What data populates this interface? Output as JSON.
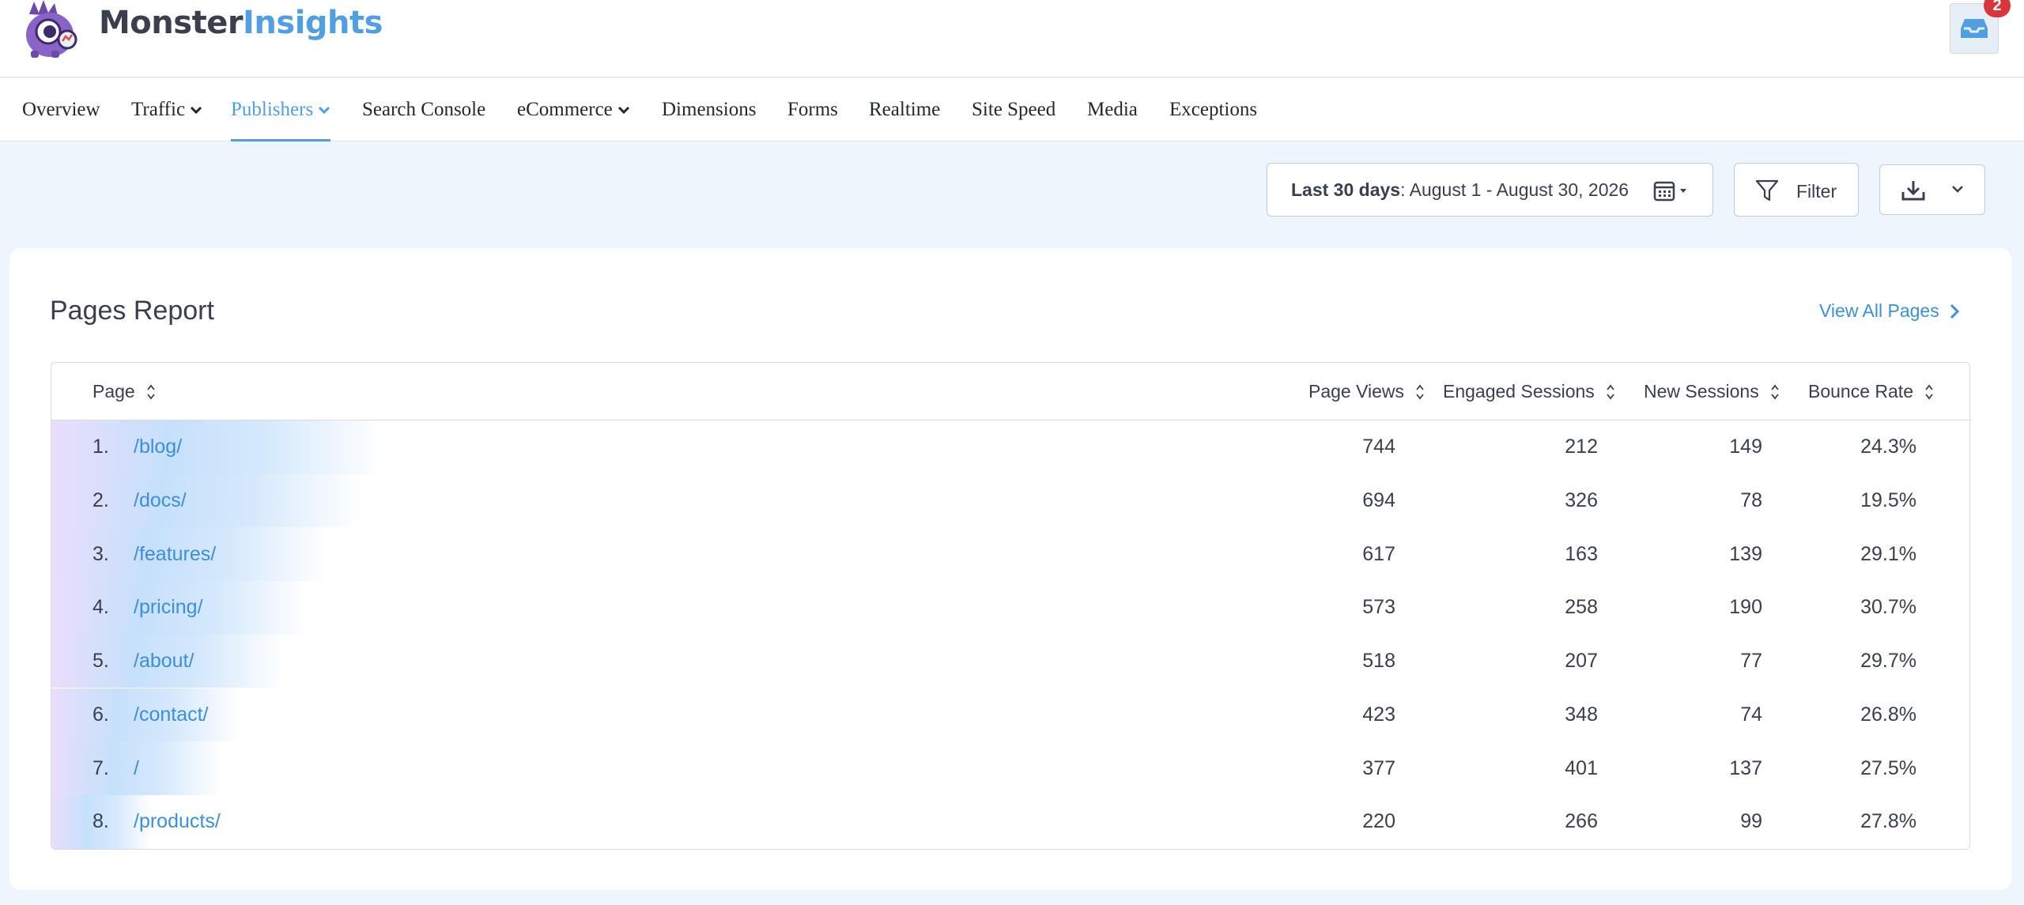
{
  "brand": {
    "monster": "Monster",
    "insights": "Insights"
  },
  "notifications": {
    "count": "2",
    "icon": "inbox-icon"
  },
  "nav": {
    "overview": "Overview",
    "traffic": "Traffic",
    "publishers": "Publishers",
    "search_console": "Search Console",
    "ecommerce": "eCommerce",
    "dimensions": "Dimensions",
    "forms": "Forms",
    "realtime": "Realtime",
    "site_speed": "Site Speed",
    "media": "Media",
    "exceptions": "Exceptions",
    "active": "Publishers"
  },
  "toolbar": {
    "date_label": "Last 30 days",
    "date_range": ": August 1 - August 30, 2026",
    "filter_label": "Filter"
  },
  "report": {
    "title": "Pages Report",
    "view_all": "View All Pages",
    "columns": {
      "page": "Page",
      "page_views": "Page Views",
      "engaged_sessions": "Engaged Sessions",
      "new_sessions": "New Sessions",
      "bounce_rate": "Bounce Rate"
    },
    "rows": [
      {
        "rank": "1.",
        "page": "/blog/",
        "page_views": "744",
        "engaged_sessions": "212",
        "new_sessions": "149",
        "bounce_rate": "24.3%",
        "share": 1.0
      },
      {
        "rank": "2.",
        "page": "/docs/",
        "page_views": "694",
        "engaged_sessions": "326",
        "new_sessions": "78",
        "bounce_rate": "19.5%",
        "share": 0.93
      },
      {
        "rank": "3.",
        "page": "/features/",
        "page_views": "617",
        "engaged_sessions": "163",
        "new_sessions": "139",
        "bounce_rate": "29.1%",
        "share": 0.83
      },
      {
        "rank": "4.",
        "page": "/pricing/",
        "page_views": "573",
        "engaged_sessions": "258",
        "new_sessions": "190",
        "bounce_rate": "30.7%",
        "share": 0.77
      },
      {
        "rank": "5.",
        "page": "/about/",
        "page_views": "518",
        "engaged_sessions": "207",
        "new_sessions": "77",
        "bounce_rate": "29.7%",
        "share": 0.7
      },
      {
        "rank": "6.",
        "page": "/contact/",
        "page_views": "423",
        "engaged_sessions": "348",
        "new_sessions": "74",
        "bounce_rate": "26.8%",
        "share": 0.57
      },
      {
        "rank": "7.",
        "page": "/",
        "page_views": "377",
        "engaged_sessions": "401",
        "new_sessions": "137",
        "bounce_rate": "27.5%",
        "share": 0.51
      },
      {
        "rank": "8.",
        "page": "/products/",
        "page_views": "220",
        "engaged_sessions": "266",
        "new_sessions": "99",
        "bounce_rate": "27.8%",
        "share": 0.3
      }
    ]
  },
  "colors": {
    "accent": "#509fe2",
    "link": "#3c8fdb",
    "badge": "#d83638",
    "text": "#393f4c"
  }
}
